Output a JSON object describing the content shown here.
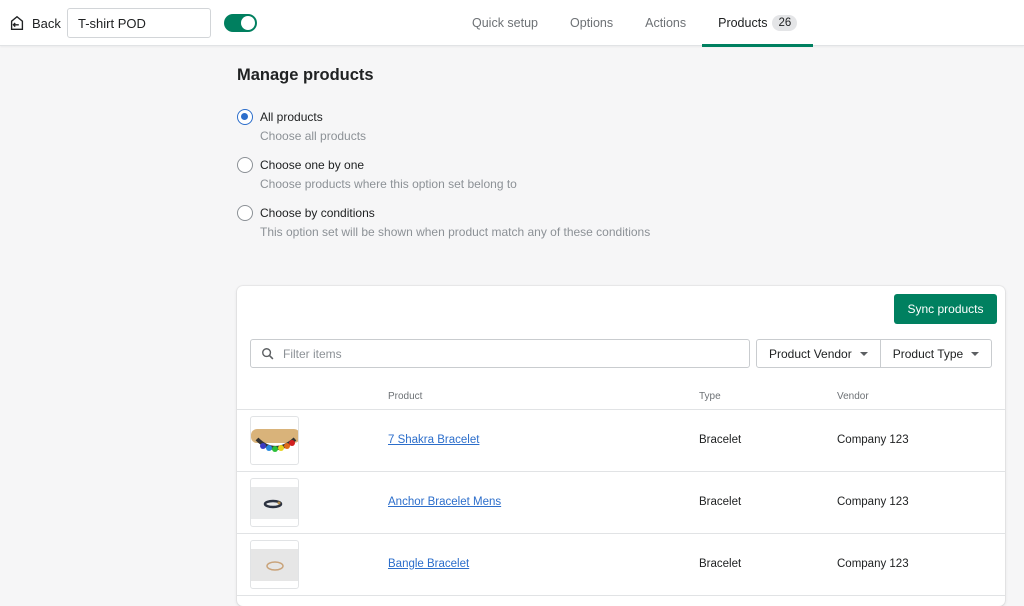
{
  "header": {
    "back_label": "Back",
    "option_set_name": "T-shirt POD",
    "enabled": true,
    "tabs": [
      {
        "label": "Quick setup"
      },
      {
        "label": "Options"
      },
      {
        "label": "Actions"
      },
      {
        "label": "Products",
        "badge": "26",
        "active": true
      }
    ]
  },
  "main": {
    "title": "Manage products",
    "options": [
      {
        "label": "All products",
        "help": "Choose all products",
        "checked": true
      },
      {
        "label": "Choose one by one",
        "help": "Choose products where this option set belong to",
        "checked": false
      },
      {
        "label": "Choose by conditions",
        "help": "This option set will be shown when product match any of these conditions",
        "checked": false
      }
    ]
  },
  "card": {
    "sync_label": "Sync products",
    "search_placeholder": "Filter items",
    "filters": [
      "Product Vendor",
      "Product Type"
    ],
    "columns": {
      "product": "Product",
      "type": "Type",
      "vendor": "Vendor"
    },
    "rows": [
      {
        "name": "7 Shakra Bracelet",
        "type": "Bracelet",
        "vendor": "Company 123"
      },
      {
        "name": "Anchor Bracelet Mens",
        "type": "Bracelet",
        "vendor": "Company 123"
      },
      {
        "name": "Bangle Bracelet",
        "type": "Bracelet",
        "vendor": "Company 123"
      }
    ]
  },
  "colors": {
    "primary": "#008060",
    "link": "#2c6ecb"
  }
}
